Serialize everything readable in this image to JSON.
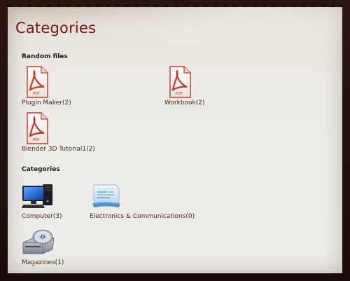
{
  "page": {
    "title": "Categories"
  },
  "random_files": {
    "heading": "Random files",
    "items": [
      {
        "name": "Plugin Maker",
        "count": "(2)",
        "icon": "pdf-file-icon"
      },
      {
        "name": "Workbook",
        "count": "(2)",
        "icon": "pdf-file-icon"
      },
      {
        "name": "Blender 3D Tutorial1",
        "count": "(2)",
        "icon": "pdf-file-icon"
      }
    ]
  },
  "categories": {
    "heading": "Categories",
    "items": [
      {
        "name": "Computer",
        "count": "(3)",
        "icon": "computer-icon"
      },
      {
        "name": "Electronics & Communications",
        "count": "(0)",
        "icon": "electronics-icon"
      },
      {
        "name": "Magazines",
        "count": "(1)",
        "icon": "disc-drive-icon"
      }
    ]
  },
  "colors": {
    "title": "#7a1612",
    "link": "#4a2a18",
    "panel": "#edebe6",
    "frame": "#1a0c0a"
  }
}
